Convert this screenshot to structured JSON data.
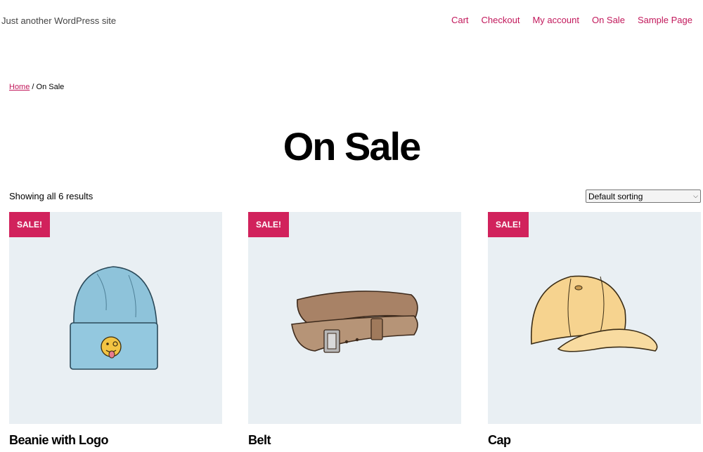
{
  "site": {
    "title": "Just another WordPress site"
  },
  "nav": {
    "items": [
      {
        "label": "Cart"
      },
      {
        "label": "Checkout"
      },
      {
        "label": "My account"
      },
      {
        "label": "On Sale"
      },
      {
        "label": "Sample Page"
      }
    ]
  },
  "breadcrumb": {
    "home": "Home",
    "separator": " / ",
    "current": "On Sale"
  },
  "page": {
    "title": "On Sale"
  },
  "results": {
    "count_text": "Showing all 6 results"
  },
  "sorting": {
    "selected": "Default sorting"
  },
  "products": [
    {
      "badge": "SALE!",
      "name": "Beanie with Logo",
      "icon": "beanie-icon"
    },
    {
      "badge": "SALE!",
      "name": "Belt",
      "icon": "belt-icon"
    },
    {
      "badge": "SALE!",
      "name": "Cap",
      "icon": "cap-icon"
    }
  ],
  "colors": {
    "accent": "#c2185b",
    "badge": "#d1225c",
    "image_bg": "#e9eff3"
  }
}
